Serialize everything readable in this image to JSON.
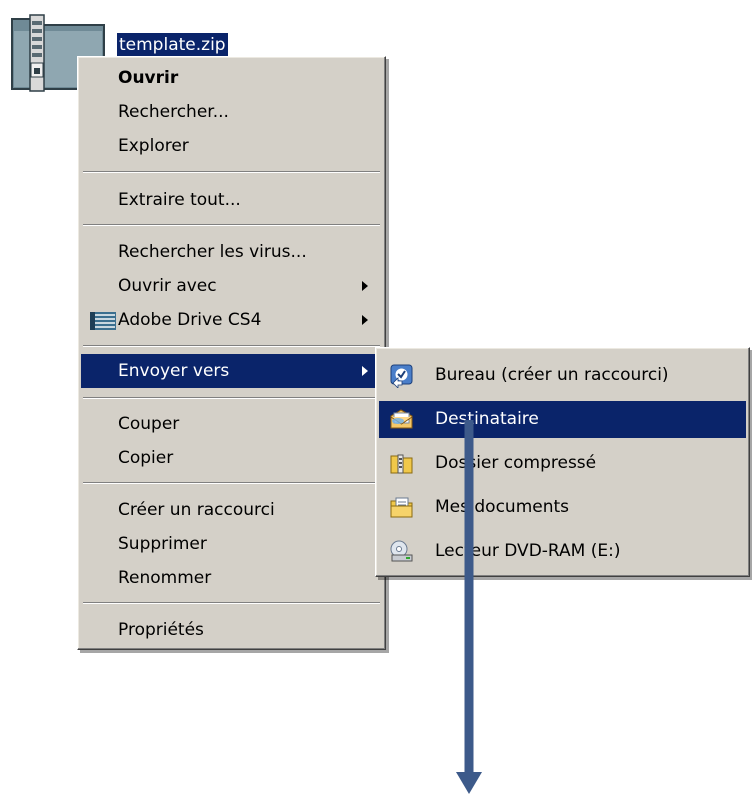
{
  "file": {
    "name": "template.zip",
    "icon": "zip-folder-icon"
  },
  "context_menu": {
    "items": [
      {
        "label": "Ouvrir"
      },
      {
        "label": "Rechercher..."
      },
      {
        "label": "Explorer"
      },
      {
        "label": "Extraire tout..."
      },
      {
        "label": "Rechercher les virus..."
      },
      {
        "label": "Ouvrir avec"
      },
      {
        "label": "Adobe Drive CS4",
        "icon": "adobe-drive-icon"
      },
      {
        "label": "Envoyer vers"
      },
      {
        "label": "Couper"
      },
      {
        "label": "Copier"
      },
      {
        "label": "Créer un raccourci"
      },
      {
        "label": "Supprimer"
      },
      {
        "label": "Renommer"
      },
      {
        "label": "Propriétés"
      }
    ]
  },
  "send_to_menu": {
    "items": [
      {
        "label": "Bureau (créer un raccourci)",
        "icon": "desktop-icon"
      },
      {
        "label": "Destinataire",
        "icon": "mail-recipient-icon"
      },
      {
        "label": "Dossier compressé",
        "icon": "compressed-folder-icon"
      },
      {
        "label": "Mes documents",
        "icon": "my-documents-icon"
      },
      {
        "label": "Lecteur DVD-RAM (E:)",
        "icon": "dvd-drive-icon"
      }
    ]
  },
  "colors": {
    "highlight": "#0a246a",
    "menu_bg": "#d4d0c8",
    "annotation_arrow": "#3d5a8a"
  }
}
